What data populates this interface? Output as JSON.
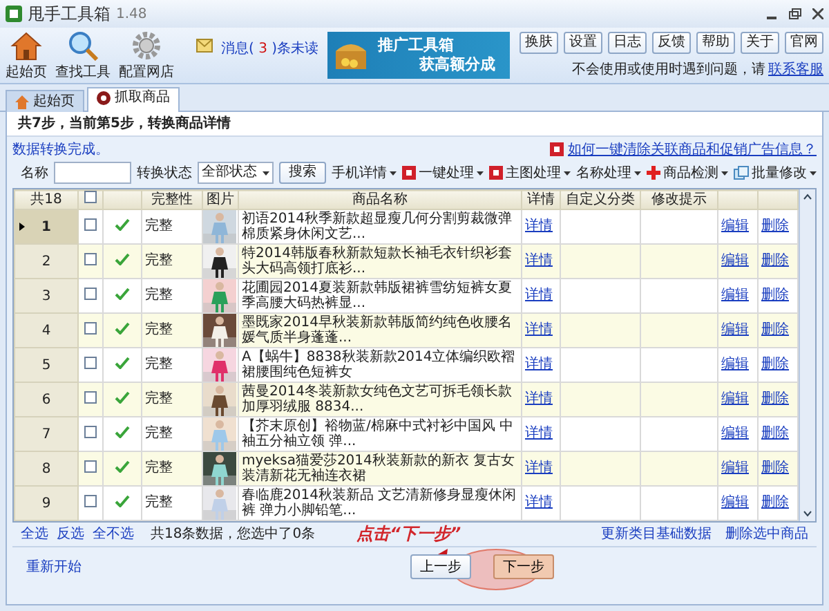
{
  "window": {
    "title": "甩手工具箱",
    "version": "1.48"
  },
  "toolbar": [
    {
      "label": "起始页",
      "kind": "home"
    },
    {
      "label": "查找工具",
      "kind": "search"
    },
    {
      "label": "配置网店",
      "kind": "gear"
    }
  ],
  "message": {
    "prefix": "消息(",
    "count": "3",
    "suffix": ")条未读"
  },
  "banner": {
    "lines": [
      "推广工具箱",
      "获高额分成"
    ]
  },
  "top_buttons": [
    "换肤",
    "设置",
    "日志",
    "反馈",
    "帮助",
    "关于",
    "官网"
  ],
  "help": {
    "text": "不会使用或使用时遇到问题，请",
    "link": "联系客服"
  },
  "tabs": [
    {
      "label": "起始页",
      "kind": "home",
      "selected": false
    },
    {
      "label": "抓取商品",
      "kind": "grab",
      "selected": true
    }
  ],
  "step_text": "共7步，当前第5步，转换商品详情",
  "status": "数据转换完成。",
  "notice_link": "如何一键清除关联商品和促销广告信息？",
  "filter": {
    "name_label": "名称",
    "status_label": "转换状态",
    "status_value": "全部状态",
    "search_button": "搜索"
  },
  "actions": [
    {
      "label": "手机详情",
      "kind": "plain"
    },
    {
      "label": "一键处理",
      "kind": "new"
    },
    {
      "label": "主图处理",
      "kind": "new"
    },
    {
      "label": "名称处理",
      "kind": "plain"
    },
    {
      "label": "商品检测",
      "kind": "cross"
    },
    {
      "label": "批量修改",
      "kind": "edit"
    }
  ],
  "table": {
    "columns": [
      "共18",
      "完整性",
      "图片",
      "商品名称",
      "详情",
      "自定义分类",
      "修改提示"
    ],
    "all_checked": false,
    "rows": [
      {
        "number": "1",
        "selected": true,
        "checked": false,
        "complete": true,
        "integrity": "完整",
        "name": "初语2014秋季新款超显瘦几何分割剪裁微弹棉质紧身休闲文艺...",
        "detail": "详情",
        "edit": "编辑",
        "delete": "删除"
      },
      {
        "number": "2",
        "selected": false,
        "checked": false,
        "complete": true,
        "integrity": "完整",
        "name": "特2014韩版春秋新款短款长袖毛衣针织衫套头大码高领打底衫...",
        "detail": "详情",
        "edit": "编辑",
        "delete": "删除"
      },
      {
        "number": "3",
        "selected": false,
        "checked": false,
        "complete": true,
        "integrity": "完整",
        "name": "花圃园2014夏装新款韩版裙裤雪纺短裤女夏季高腰大码热裤显...",
        "detail": "详情",
        "edit": "编辑",
        "delete": "删除"
      },
      {
        "number": "4",
        "selected": false,
        "checked": false,
        "complete": true,
        "integrity": "完整",
        "name": "墨既家2014早秋装新款韩版简约纯色收腰名媛气质半身蓬蓬...",
        "detail": "详情",
        "edit": "编辑",
        "delete": "删除"
      },
      {
        "number": "5",
        "selected": false,
        "checked": false,
        "complete": true,
        "integrity": "完整",
        "name": "A【蜗牛】8838秋装新款2014立体编织欧褶裙腰围纯色短裤女",
        "detail": "详情",
        "edit": "编辑",
        "delete": "删除"
      },
      {
        "number": "6",
        "selected": false,
        "checked": false,
        "complete": true,
        "integrity": "完整",
        "name": "茜曼2014冬装新款女纯色文艺可拆毛领长款加厚羽绒服 8834...",
        "detail": "详情",
        "edit": "编辑",
        "delete": "删除"
      },
      {
        "number": "7",
        "selected": false,
        "checked": false,
        "complete": true,
        "integrity": "完整",
        "name": "【芥末原创】裕物蓝/棉麻中式衬衫中国风 中袖五分袖立领 弹...",
        "detail": "详情",
        "edit": "编辑",
        "delete": "删除"
      },
      {
        "number": "8",
        "selected": false,
        "checked": false,
        "complete": true,
        "integrity": "完整",
        "name": "myeksa猫爱莎2014秋装新款的新衣 复古女装清新花无袖连衣裙",
        "detail": "详情",
        "edit": "编辑",
        "delete": "删除"
      },
      {
        "number": "9",
        "selected": false,
        "checked": false,
        "complete": true,
        "integrity": "完整",
        "name": "春临鹿2014秋装新品 文艺清新修身显瘦休闲裤 弹力小脚铅笔...",
        "detail": "详情",
        "edit": "编辑",
        "delete": "删除"
      }
    ]
  },
  "selection_links": [
    "全选",
    "反选",
    "全不选"
  ],
  "count_text": "共18条数据，您选中了0条",
  "right_links": [
    "更新类目基础数据",
    "删除选中商品"
  ],
  "annotation": "点击“下一步”",
  "bottom": {
    "restart": "重新开始",
    "prev": "上一步",
    "next": "下一步"
  }
}
